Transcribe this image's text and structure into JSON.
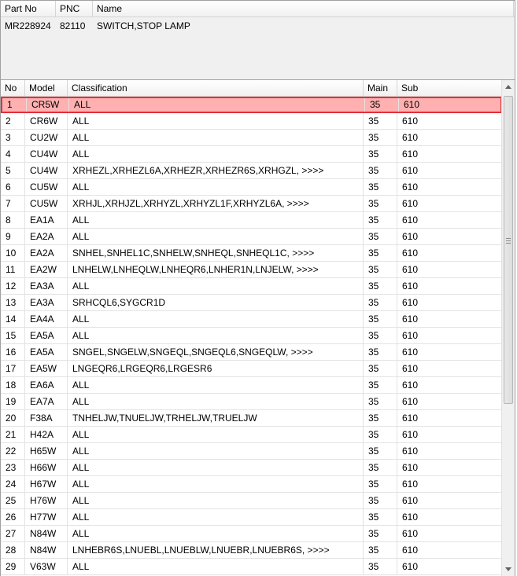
{
  "parts_table": {
    "columns": [
      "Part No",
      "PNC",
      "Name"
    ],
    "rows": [
      {
        "part_no": "MR228924",
        "pnc": "82110",
        "name": "SWITCH,STOP LAMP"
      }
    ]
  },
  "models_table": {
    "columns": [
      "No",
      "Model",
      "Classification",
      "Main",
      "Sub"
    ],
    "selected_index": 0,
    "rows": [
      {
        "no": "1",
        "model": "CR5W",
        "classification": "ALL",
        "main": "35",
        "sub": "610"
      },
      {
        "no": "2",
        "model": "CR6W",
        "classification": "ALL",
        "main": "35",
        "sub": "610"
      },
      {
        "no": "3",
        "model": "CU2W",
        "classification": "ALL",
        "main": "35",
        "sub": "610"
      },
      {
        "no": "4",
        "model": "CU4W",
        "classification": "ALL",
        "main": "35",
        "sub": "610"
      },
      {
        "no": "5",
        "model": "CU4W",
        "classification": "XRHEZL,XRHEZL6A,XRHEZR,XRHEZR6S,XRHGZL,  >>>>",
        "main": "35",
        "sub": "610"
      },
      {
        "no": "6",
        "model": "CU5W",
        "classification": "ALL",
        "main": "35",
        "sub": "610"
      },
      {
        "no": "7",
        "model": "CU5W",
        "classification": "XRHJL,XRHJZL,XRHYZL,XRHYZL1F,XRHYZL6A,  >>>>",
        "main": "35",
        "sub": "610"
      },
      {
        "no": "8",
        "model": "EA1A",
        "classification": "ALL",
        "main": "35",
        "sub": "610"
      },
      {
        "no": "9",
        "model": "EA2A",
        "classification": "ALL",
        "main": "35",
        "sub": "610"
      },
      {
        "no": "10",
        "model": "EA2A",
        "classification": "SNHEL,SNHEL1C,SNHELW,SNHEQL,SNHEQL1C,  >>>>",
        "main": "35",
        "sub": "610"
      },
      {
        "no": "11",
        "model": "EA2W",
        "classification": "LNHELW,LNHEQLW,LNHEQR6,LNHER1N,LNJELW,  >>>>",
        "main": "35",
        "sub": "610"
      },
      {
        "no": "12",
        "model": "EA3A",
        "classification": "ALL",
        "main": "35",
        "sub": "610"
      },
      {
        "no": "13",
        "model": "EA3A",
        "classification": "SRHCQL6,SYGCR1D",
        "main": "35",
        "sub": "610"
      },
      {
        "no": "14",
        "model": "EA4A",
        "classification": "ALL",
        "main": "35",
        "sub": "610"
      },
      {
        "no": "15",
        "model": "EA5A",
        "classification": "ALL",
        "main": "35",
        "sub": "610"
      },
      {
        "no": "16",
        "model": "EA5A",
        "classification": "SNGEL,SNGELW,SNGEQL,SNGEQL6,SNGEQLW,  >>>>",
        "main": "35",
        "sub": "610"
      },
      {
        "no": "17",
        "model": "EA5W",
        "classification": "LNGEQR6,LRGEQR6,LRGESR6",
        "main": "35",
        "sub": "610"
      },
      {
        "no": "18",
        "model": "EA6A",
        "classification": "ALL",
        "main": "35",
        "sub": "610"
      },
      {
        "no": "19",
        "model": "EA7A",
        "classification": "ALL",
        "main": "35",
        "sub": "610"
      },
      {
        "no": "20",
        "model": "F38A",
        "classification": "TNHELJW,TNUELJW,TRHELJW,TRUELJW",
        "main": "35",
        "sub": "610"
      },
      {
        "no": "21",
        "model": "H42A",
        "classification": "ALL",
        "main": "35",
        "sub": "610"
      },
      {
        "no": "22",
        "model": "H65W",
        "classification": "ALL",
        "main": "35",
        "sub": "610"
      },
      {
        "no": "23",
        "model": "H66W",
        "classification": "ALL",
        "main": "35",
        "sub": "610"
      },
      {
        "no": "24",
        "model": "H67W",
        "classification": "ALL",
        "main": "35",
        "sub": "610"
      },
      {
        "no": "25",
        "model": "H76W",
        "classification": "ALL",
        "main": "35",
        "sub": "610"
      },
      {
        "no": "26",
        "model": "H77W",
        "classification": "ALL",
        "main": "35",
        "sub": "610"
      },
      {
        "no": "27",
        "model": "N84W",
        "classification": "ALL",
        "main": "35",
        "sub": "610"
      },
      {
        "no": "28",
        "model": "N84W",
        "classification": "LNHEBR6S,LNUEBL,LNUEBLW,LNUEBR,LNUEBR6S,  >>>>",
        "main": "35",
        "sub": "610"
      },
      {
        "no": "29",
        "model": "V63W",
        "classification": "ALL",
        "main": "35",
        "sub": "610"
      }
    ]
  },
  "scrollbar": {
    "up_icon": "triangle-up",
    "down_icon": "triangle-down",
    "grip_icon": "grip-lines"
  },
  "colors": {
    "selected_row_fill": "#ffb0b0",
    "selected_row_border": "#e0303a"
  }
}
